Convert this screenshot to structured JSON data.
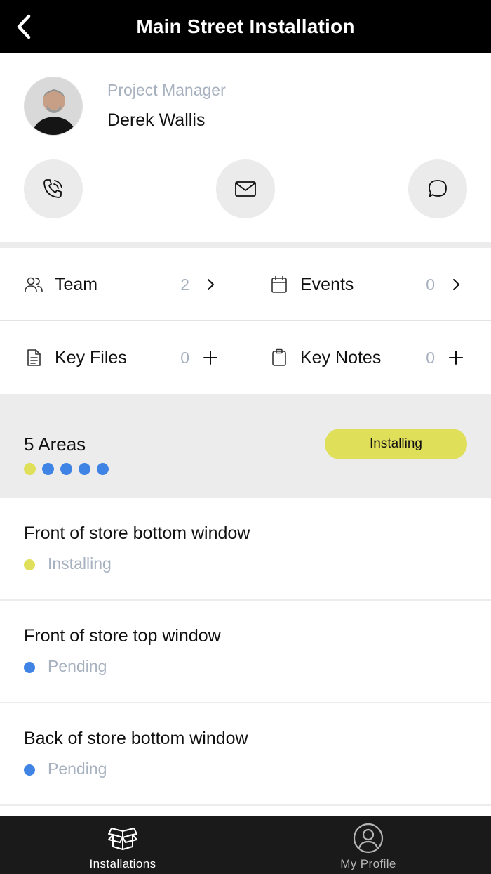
{
  "header": {
    "title": "Main Street Installation"
  },
  "project_manager": {
    "role": "Project Manager",
    "name": "Derek Wallis"
  },
  "actions": [
    "phone-icon",
    "mail-icon",
    "chat-icon"
  ],
  "grid": {
    "team": {
      "label": "Team",
      "count": "2",
      "icon": "people-icon"
    },
    "events": {
      "label": "Events",
      "count": "0",
      "icon": "calendar-icon"
    },
    "key_files": {
      "label": "Key Files",
      "count": "0",
      "icon": "file-icon"
    },
    "key_notes": {
      "label": "Key Notes",
      "count": "0",
      "icon": "clipboard-icon"
    }
  },
  "areas": {
    "count_label": "5 Areas",
    "status_pill": "Installing",
    "dots": [
      "installing",
      "pending",
      "pending",
      "pending",
      "pending"
    ]
  },
  "area_list": [
    {
      "title": "Front of store bottom window",
      "status": "Installing",
      "state": "installing"
    },
    {
      "title": "Front of store top window",
      "status": "Pending",
      "state": "pending"
    },
    {
      "title": "Back of store bottom window",
      "status": "Pending",
      "state": "pending"
    }
  ],
  "tabbar": {
    "installations": {
      "label": "Installations",
      "icon": "box-icon",
      "active": true
    },
    "my_profile": {
      "label": "My Profile",
      "icon": "user-circle-icon",
      "active": false
    }
  },
  "colors": {
    "installing": "#dfdf5a",
    "pending": "#3f84e5",
    "muted_text": "#a7b1bf",
    "tab_active": "#ffffff",
    "tab_inactive": "#b5b5b5"
  }
}
